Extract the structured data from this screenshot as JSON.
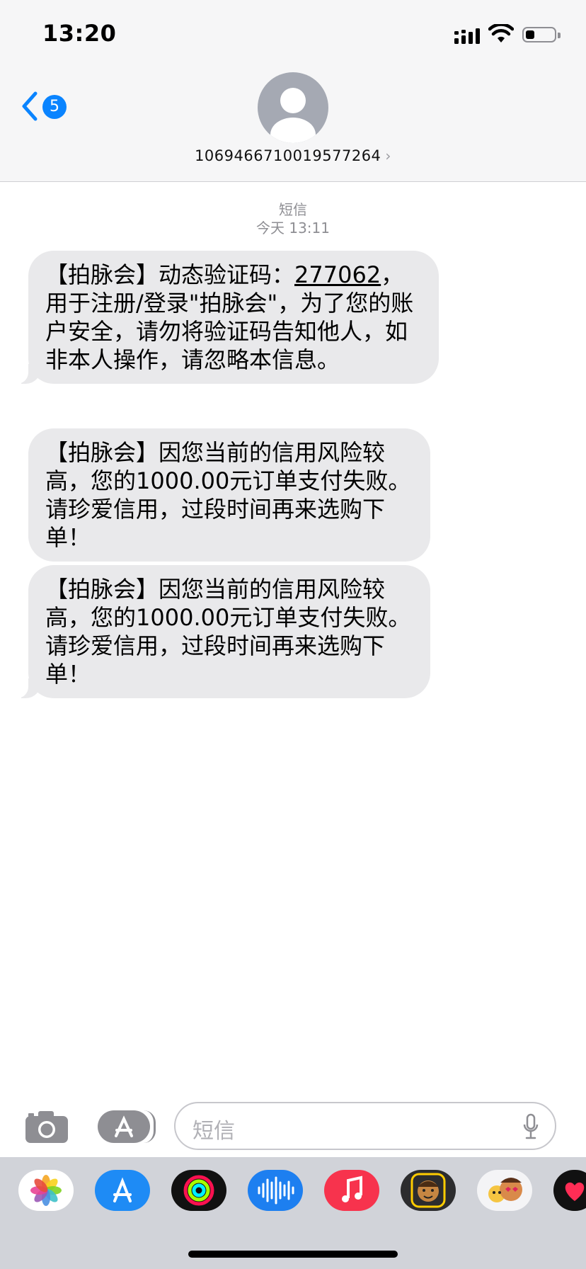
{
  "status_bar": {
    "time": "13:20",
    "battery_level": 0.3
  },
  "header": {
    "back_badge": "5",
    "contact": "1069466710019577264",
    "chevron": "›"
  },
  "thread": {
    "label": "短信",
    "timestamp": "今天 13:11",
    "messages": [
      {
        "prefix": "【拍脉会】动态验证码：",
        "code": "277062",
        "suffix": "，用于注册/登录\"拍脉会\"，为了您的账户安全，请勿将验证码告知他人，如非本人操作，请忽略本信息。"
      },
      {
        "text": "【拍脉会】因您当前的信用风险较高，您的1000.00元订单支付失败。请珍爱信用，过段时间再来选购下单！"
      },
      {
        "text": "【拍脉会】因您当前的信用风险较高，您的1000.00元订单支付失败。请珍爱信用，过段时间再来选购下单！"
      }
    ]
  },
  "composer": {
    "placeholder": "短信"
  },
  "drawer": {
    "apps": [
      "photos-app-icon",
      "app-store-app-icon",
      "fitness-app-icon",
      "voice-memo-app-icon",
      "music-app-icon",
      "memoji-app-icon",
      "animoji-app-icon",
      "digital-touch-app-icon"
    ]
  },
  "colors": {
    "accent": "#0a84ff",
    "bubble": "#e9e9eb",
    "header_bg": "#f6f6f7",
    "drawer_bg": "#d1d3d9"
  }
}
